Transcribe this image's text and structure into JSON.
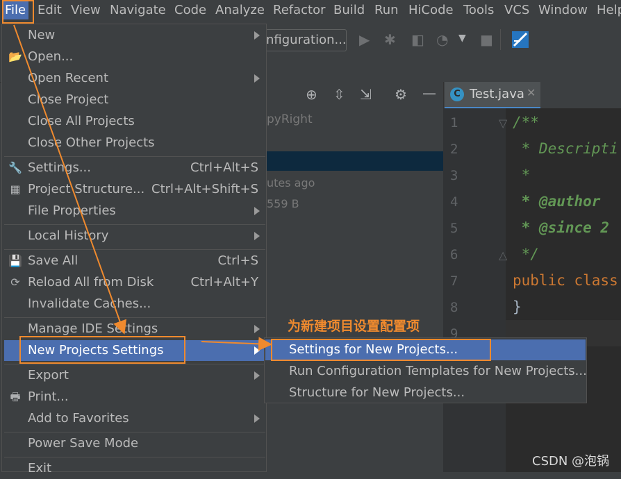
{
  "menubar": {
    "items": [
      "File",
      "Edit",
      "View",
      "Navigate",
      "Code",
      "Analyze",
      "Refactor",
      "Build",
      "Run",
      "HiCode",
      "Tools",
      "VCS",
      "Window",
      "Help"
    ]
  },
  "toolbar": {
    "run_config_label": "nfiguration..."
  },
  "tool_window": {
    "hint": "pyRight",
    "info_time": "utes ago",
    "info_size": "559 B"
  },
  "editor": {
    "tab_label": "Test.java",
    "tab_icon": "C",
    "lines": [
      {
        "num": "1",
        "text": "/**"
      },
      {
        "num": "2",
        "text": " * Descripti"
      },
      {
        "num": "3",
        "text": " *"
      },
      {
        "num": "4",
        "text": " * @author "
      },
      {
        "num": "5",
        "text": " * @since 2"
      },
      {
        "num": "6",
        "text": " */"
      },
      {
        "num": "7",
        "text": "public class"
      },
      {
        "num": "8",
        "text": "}"
      },
      {
        "num": "9",
        "text": ""
      }
    ]
  },
  "file_menu": {
    "items": [
      {
        "label": "New",
        "shortcut": "",
        "submenu": true,
        "icon": ""
      },
      {
        "label": "Open...",
        "shortcut": "",
        "submenu": false,
        "icon": "folder-icon"
      },
      {
        "label": "Open Recent",
        "shortcut": "",
        "submenu": true,
        "icon": ""
      },
      {
        "label": "Close Project",
        "shortcut": "",
        "submenu": false,
        "icon": ""
      },
      {
        "label": "Close All Projects",
        "shortcut": "",
        "submenu": false,
        "icon": ""
      },
      {
        "label": "Close Other Projects",
        "shortcut": "",
        "submenu": false,
        "icon": ""
      },
      {
        "label": "Settings...",
        "shortcut": "Ctrl+Alt+S",
        "submenu": false,
        "icon": "wrench-icon"
      },
      {
        "label": "Project Structure...",
        "shortcut": "Ctrl+Alt+Shift+S",
        "submenu": false,
        "icon": "project-structure-icon"
      },
      {
        "label": "File Properties",
        "shortcut": "",
        "submenu": true,
        "icon": ""
      },
      {
        "label": "Local History",
        "shortcut": "",
        "submenu": true,
        "icon": ""
      },
      {
        "label": "Save All",
        "shortcut": "Ctrl+S",
        "submenu": false,
        "icon": "save-icon"
      },
      {
        "label": "Reload All from Disk",
        "shortcut": "Ctrl+Alt+Y",
        "submenu": false,
        "icon": "reload-icon"
      },
      {
        "label": "Invalidate Caches...",
        "shortcut": "",
        "submenu": false,
        "icon": ""
      },
      {
        "label": "Manage IDE Settings",
        "shortcut": "",
        "submenu": true,
        "icon": ""
      },
      {
        "label": "New Projects Settings",
        "shortcut": "",
        "submenu": true,
        "icon": ""
      },
      {
        "label": "Export",
        "shortcut": "",
        "submenu": true,
        "icon": ""
      },
      {
        "label": "Print...",
        "shortcut": "",
        "submenu": false,
        "icon": "print-icon"
      },
      {
        "label": "Add to Favorites",
        "shortcut": "",
        "submenu": true,
        "icon": ""
      },
      {
        "label": "Power Save Mode",
        "shortcut": "",
        "submenu": false,
        "icon": ""
      },
      {
        "label": "Exit",
        "shortcut": "",
        "submenu": false,
        "icon": ""
      }
    ]
  },
  "submenu": {
    "items": [
      {
        "label": "Settings for New Projects..."
      },
      {
        "label": "Run Configuration Templates for New Projects..."
      },
      {
        "label": "Structure for New Projects..."
      }
    ]
  },
  "annotation": {
    "text": "为新建项目设置配置项",
    "color": "#f08a2e"
  },
  "watermark": "CSDN @泡锅",
  "colors": {
    "menu_highlight": "#4b6eaf",
    "background": "#3c3f41",
    "editor_bg": "#2b2b2b",
    "comment": "#629755",
    "keyword": "#cc7832"
  }
}
